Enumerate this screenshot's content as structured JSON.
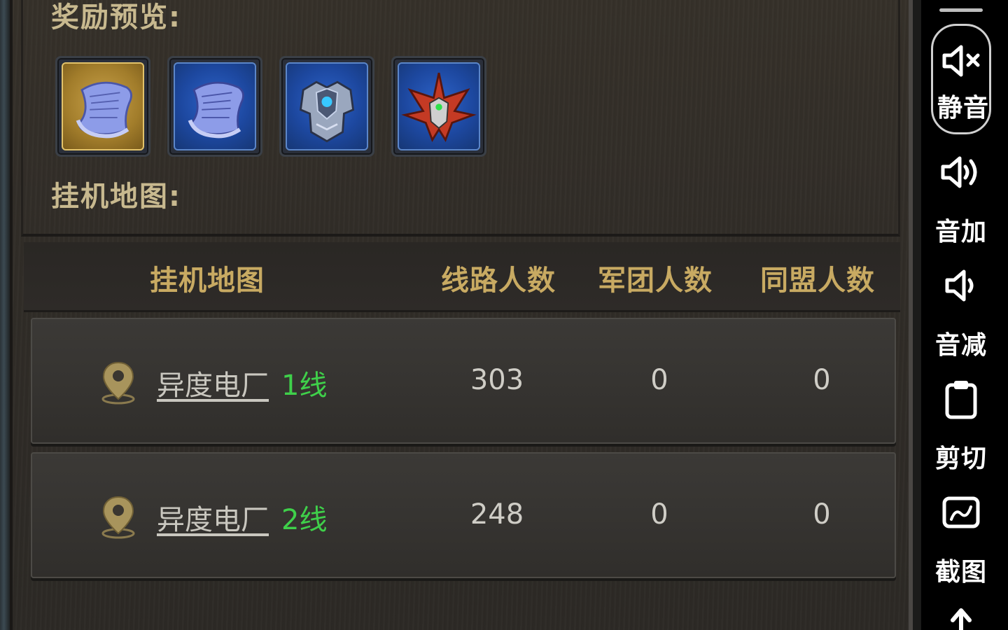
{
  "rewards": {
    "label": "奖励预览:",
    "items": [
      {
        "icon": "scroll-icon",
        "rarity": "gold"
      },
      {
        "icon": "scroll-icon",
        "rarity": "blue"
      },
      {
        "icon": "armor-icon",
        "rarity": "blue"
      },
      {
        "icon": "spiked-helmet-icon",
        "rarity": "blue"
      }
    ]
  },
  "idle_map": {
    "label": "挂机地图:"
  },
  "table": {
    "headers": {
      "map": "挂机地图",
      "line_players": "线路人数",
      "legion_players": "军团人数",
      "alliance_players": "同盟人数"
    },
    "rows": [
      {
        "map_name": "异度电厂",
        "line": "1线",
        "line_players": "303",
        "legion_players": "0",
        "alliance_players": "0"
      },
      {
        "map_name": "异度电厂",
        "line": "2线",
        "line_players": "248",
        "legion_players": "0",
        "alliance_players": "0"
      }
    ]
  },
  "toolbar": {
    "mute": "静音",
    "volume_up": "音加",
    "volume_down": "音减",
    "clip": "剪切",
    "screenshot": "截图"
  },
  "colors": {
    "header_text": "#c8aa62",
    "line_tag_green": "#3fd04a",
    "reward_gold": "#c9a24a",
    "reward_blue": "#1d48a0"
  }
}
